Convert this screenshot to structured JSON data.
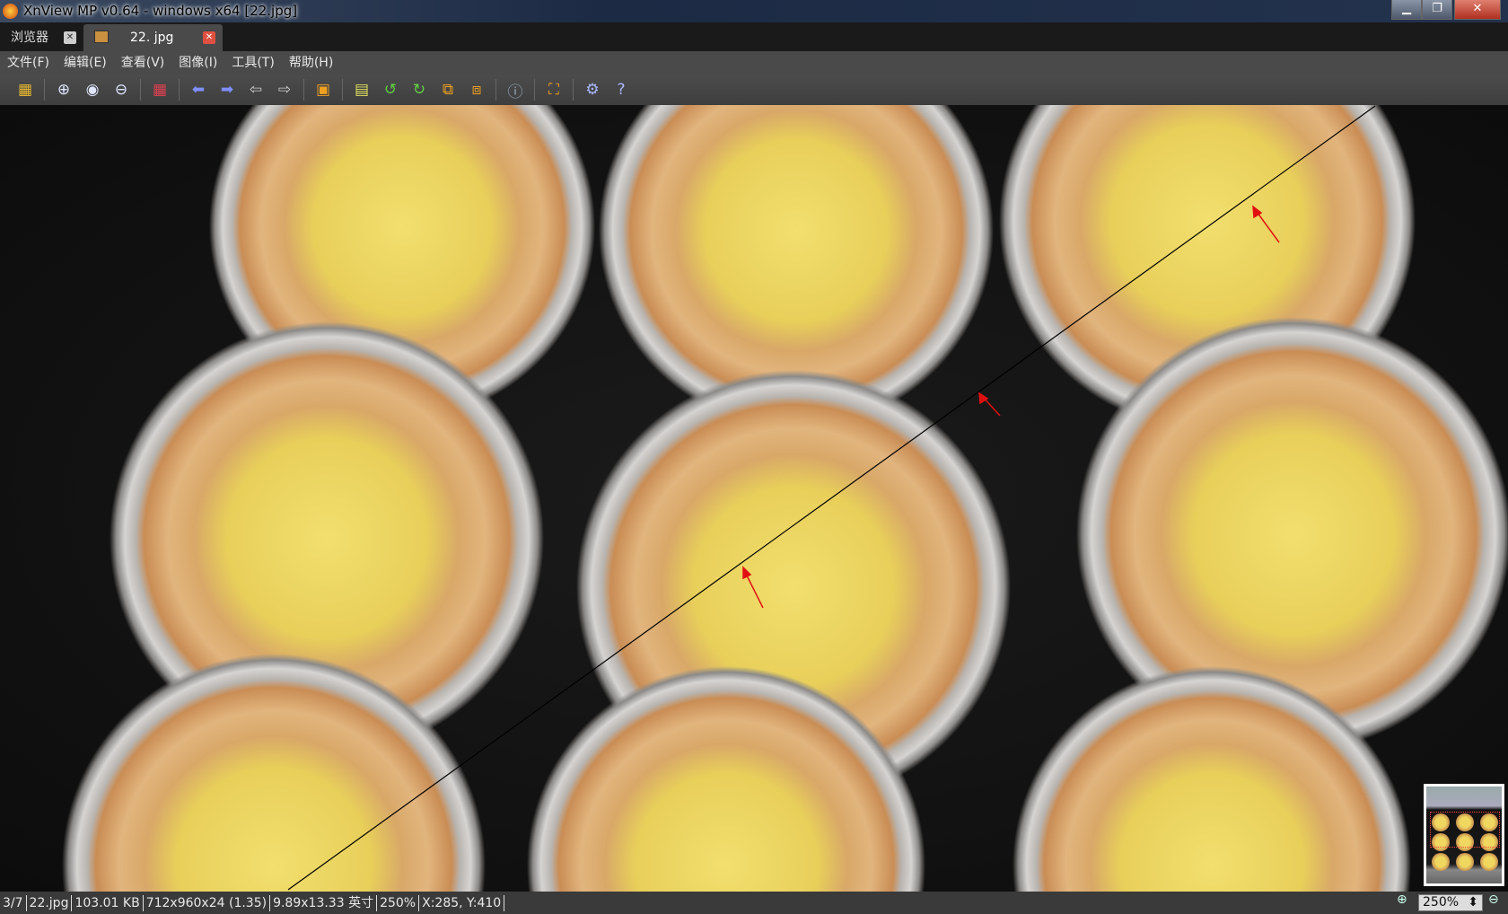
{
  "window": {
    "title": "XnView MP v0.64 - windows x64 [22.jpg]",
    "minimize": "▁",
    "maximize": "❐",
    "close": "✕"
  },
  "tabs": [
    {
      "label": "浏览器",
      "close": "✕"
    },
    {
      "label": "22. jpg",
      "close": "✕"
    }
  ],
  "menu": [
    "文件(F)",
    "编辑(E)",
    "查看(V)",
    "图像(I)",
    "工具(T)",
    "帮助(H)"
  ],
  "toolbar": [
    {
      "icon": "folder-tree-icon",
      "glyph": "▦",
      "color": "#e8b830"
    },
    {
      "sep": true
    },
    {
      "icon": "zoom-in-icon",
      "glyph": "⊕",
      "color": "#dfe6ff"
    },
    {
      "icon": "zoom-actual-icon",
      "glyph": "◉",
      "color": "#dfe6ff"
    },
    {
      "icon": "zoom-out-icon",
      "glyph": "⊖",
      "color": "#dfe6ff"
    },
    {
      "sep": true
    },
    {
      "icon": "grid-icon",
      "glyph": "▦",
      "color": "#e04050"
    },
    {
      "sep": true
    },
    {
      "icon": "previous-icon",
      "glyph": "⬅",
      "color": "#8090ff"
    },
    {
      "icon": "next-icon",
      "glyph": "➡",
      "color": "#8090ff"
    },
    {
      "icon": "first-page-icon",
      "glyph": "⇦",
      "color": "#ccc"
    },
    {
      "icon": "last-page-icon",
      "glyph": "⇨",
      "color": "#ccc"
    },
    {
      "sep": true
    },
    {
      "icon": "slideshow-icon",
      "glyph": "▣",
      "color": "#f0a020"
    },
    {
      "sep": true
    },
    {
      "icon": "adjust-colors-icon",
      "glyph": "▤",
      "color": "#e0e060"
    },
    {
      "icon": "rotate-left-icon",
      "glyph": "↺",
      "color": "#60d040"
    },
    {
      "icon": "rotate-right-icon",
      "glyph": "↻",
      "color": "#60d040"
    },
    {
      "icon": "crop-icon",
      "glyph": "⧉",
      "color": "#f0a020"
    },
    {
      "icon": "resize-icon",
      "glyph": "⧈",
      "color": "#f0a020"
    },
    {
      "sep": true
    },
    {
      "icon": "info-icon",
      "glyph": "ⓘ",
      "color": "#9ab"
    },
    {
      "sep": true
    },
    {
      "icon": "fullscreen-icon",
      "glyph": "⛶",
      "color": "#f0a020"
    },
    {
      "sep": true
    },
    {
      "icon": "settings-icon",
      "glyph": "⚙",
      "color": "#aab8ff"
    },
    {
      "icon": "help-icon",
      "glyph": "?",
      "color": "#aab8ff"
    }
  ],
  "status": {
    "index": "3/7",
    "filename": "22.jpg",
    "filesize": "103.01 KB",
    "dimensions": "712x960x24 (1.35)",
    "print_size": "9.89x13.33 英寸",
    "zoom": "250%",
    "coords": "X:285, Y:410"
  },
  "zoom_control": {
    "value": "250%",
    "spinner": "⬍"
  }
}
